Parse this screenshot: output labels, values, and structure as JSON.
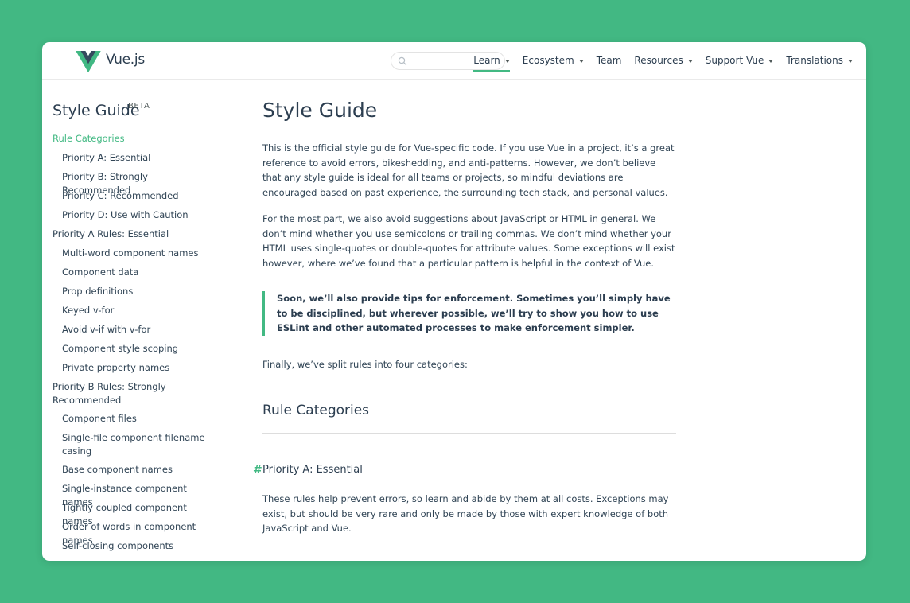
{
  "header": {
    "logo_text": "Vue.js",
    "search_placeholder": "",
    "nav": [
      {
        "label": "Learn",
        "dropdown": true,
        "active": true
      },
      {
        "label": "Ecosystem",
        "dropdown": true
      },
      {
        "label": "Team",
        "dropdown": false
      },
      {
        "label": "Resources",
        "dropdown": true
      },
      {
        "label": "Support Vue",
        "dropdown": true
      },
      {
        "label": "Translations",
        "dropdown": true
      }
    ]
  },
  "sidebar": {
    "title": "Style Guide",
    "badge": "BETA",
    "items": [
      {
        "label": "Rule Categories",
        "level": 0,
        "active": true
      },
      {
        "label": "Priority A: Essential",
        "level": 1
      },
      {
        "label": "Priority B: Strongly Recommended",
        "level": 1
      },
      {
        "label": "Priority C: Recommended",
        "level": 1
      },
      {
        "label": "Priority D: Use with Caution",
        "level": 1
      },
      {
        "label": "Priority A Rules: Essential",
        "level": 0
      },
      {
        "label": "Multi-word component names",
        "level": 1
      },
      {
        "label": "Component data",
        "level": 1
      },
      {
        "label": "Prop definitions",
        "level": 1
      },
      {
        "label": "Keyed v-for",
        "level": 1
      },
      {
        "label": "Avoid v-if with v-for",
        "level": 1
      },
      {
        "label": "Component style scoping",
        "level": 1
      },
      {
        "label": "Private property names",
        "level": 1
      },
      {
        "label": "Priority B Rules: Strongly Recommended",
        "level": 0
      },
      {
        "label": "Component files",
        "level": 1
      },
      {
        "label": "Single-file component filename casing",
        "level": 1
      },
      {
        "label": "Base component names",
        "level": 1
      },
      {
        "label": "Single-instance component names",
        "level": 1
      },
      {
        "label": "Tightly coupled component names",
        "level": 1
      },
      {
        "label": "Order of words in component names",
        "level": 1
      },
      {
        "label": "Self-closing components",
        "level": 1
      }
    ]
  },
  "main": {
    "title": "Style Guide",
    "intro": "This is the official style guide for Vue-specific code. If you use Vue in a project, it’s a great reference to avoid errors, bikeshedding, and anti-patterns. However, we don’t believe that any style guide is ideal for all teams or projects, so mindful deviations are encouraged based on past experience, the surrounding tech stack, and personal values.",
    "para2": "For the most part, we also avoid suggestions about JavaScript or HTML in general. We don’t mind whether you use semicolons or trailing commas. We don’t mind whether your HTML uses single-quotes or double-quotes for attribute values. Some exceptions will exist however, where we’ve found that a particular pattern is helpful in the context of Vue.",
    "tip": "Soon, we’ll also provide tips for enforcement. Sometimes you’ll simply have to be disciplined, but wherever possible, we’ll try to show you how to use ESLint and other automated processes to make enforcement simpler.",
    "para3": "Finally, we’ve split rules into four categories:",
    "section_heading": "Rule Categories",
    "sub_heading_hash": "#",
    "sub_heading": "Priority A: Essential",
    "sub_para": "These rules help prevent errors, so learn and abide by them at all costs. Exceptions may exist, but should be very rare and only be made by those with expert knowledge of both JavaScript and Vue."
  },
  "colors": {
    "background": "#42b883",
    "accent": "#42b983",
    "text": "#2c3e50",
    "logo_dark": "#35495e",
    "logo_light": "#41b883"
  }
}
